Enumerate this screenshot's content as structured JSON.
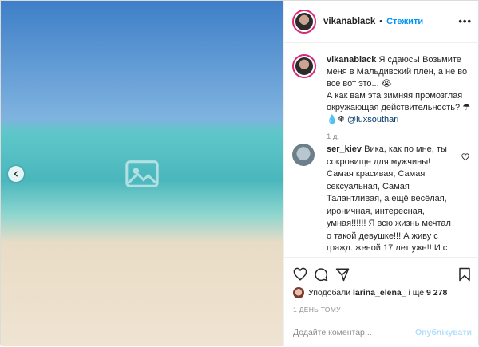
{
  "media": {
    "placeholder_icon": "image-icon"
  },
  "header": {
    "username": "vikanablack",
    "dot": "•",
    "follow_label": "Стежити",
    "more_label": "•••"
  },
  "caption": {
    "username": "vikanablack",
    "text_1": "Я сдаюсь! Возьмите меня в Мальдивский плен, а не во все вот это... 😭",
    "text_2": "А как вам эта зимняя промозглая окружающая действительность? ☂",
    "text_3": "💧❄",
    "mention": "@luxsouthari",
    "time": "1 д."
  },
  "comment": {
    "username": "ser_kiev",
    "text": "Вика, как по мне, ты сокровище для мужчины! Самая красивая, Самая сексуальная, Самая Талантливая, а ещё весёлая, ироничная, интересная, умная!!!!!! Я всю жизнь мечтал о такой девушке!!! А живу с гражд. женой 17 лет уже!! И с каждым годом мне все более не о чем говорить с ней, неинтересно! Ты"
  },
  "actions": {
    "likes_prefix": "Уподобали",
    "likes_user": "larina_elena_",
    "likes_middle": "і ще",
    "likes_count": "9 278",
    "date": "1 ДЕНЬ ТОМУ"
  },
  "add_comment": {
    "placeholder": "Додайте коментар...",
    "publish_label": "Опублікувати"
  },
  "colors": {
    "accent": "#0095f6",
    "publish_disabled": "#b2dffc",
    "muted": "#8e8e8e"
  }
}
